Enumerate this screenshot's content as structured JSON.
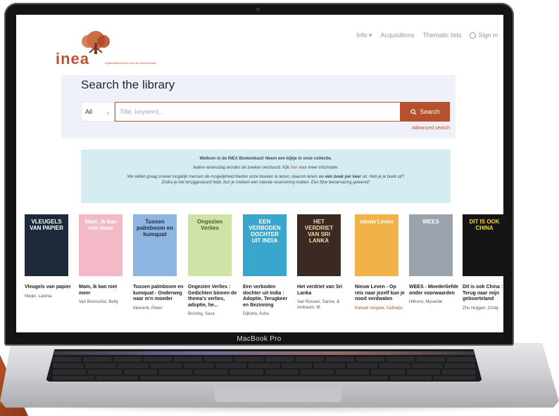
{
  "device": {
    "label": "MacBook Pro"
  },
  "brand": {
    "logo_text": "inea",
    "logo_subtitle": "organisatiecentrum voor de fijne educatie"
  },
  "nav": {
    "info": "Info",
    "acquisitions": "Acquisitions",
    "thematic_lists": "Thematic lists",
    "sign_in": "Sign in"
  },
  "search": {
    "title": "Search the library",
    "scope": "All",
    "placeholder": "Title, keyword...",
    "button": "Search",
    "advanced": "Advanced search"
  },
  "welcome": {
    "line1": "Welkom in de INEA Boekenkast! Neem een kijkje in onze collectie.",
    "line2_a": "Iedere woensdag worden de boeken verstuurd. Kijk ",
    "line2_link": "hier",
    "line2_b": " voor meer informatie.",
    "line3_a": "We willen graag zoveel mogelijk mensen de mogelijkheid bieden onze boeken te lezen, daarom lenen we ",
    "line3_bold": "één boek per keer",
    "line3_b": " uit. Heb je je boek uit?",
    "line4": "Zodra je het teruggestuurd hebt, kun je meteen een nieuwe reservering maken. Een fijne leeservaring gewenst!"
  },
  "books": [
    {
      "title": "Vleugels van papier",
      "author": "Meijer, Lavinia",
      "cover_text": "VLEUGELS VAN PAPIER",
      "cover_bg": "#1d2a3a",
      "cover_fg": "#ffffff",
      "author_red": false
    },
    {
      "title": "Mam, ik kan niet meer",
      "author": "Van Brunschot, Betty",
      "cover_text": "Mam, ik kan niet meer",
      "cover_bg": "#f4b9c7",
      "cover_fg": "#ffffff",
      "author_red": false
    },
    {
      "title": "Tussen palmboom en kumquat - Onderweg naar m'n moeder",
      "author": "Meenink, Pieter",
      "cover_text": "Tussen palmboom en kumquat",
      "cover_bg": "#8fb6e0",
      "cover_fg": "#1c2d4a",
      "author_red": false
    },
    {
      "title": "Ongezien Verlies : Gedichten binnen de thema's verlies, adoptie, he...",
      "author": "Brüning, Sasa",
      "cover_text": "Ongezien Verlies",
      "cover_bg": "#cfe3a8",
      "cover_fg": "#4a5a2a",
      "author_red": false
    },
    {
      "title": "Een verboden dochter uit India : Adoptie, Terugkeer en Bezinning",
      "author": "Dijkstra, Asha",
      "cover_text": "EEN VERBODEN DOCHTER UIT INDIA",
      "cover_bg": "#3aa6cc",
      "cover_fg": "#ffffff",
      "author_red": false
    },
    {
      "title": "Het verdriet van Sri Lanka",
      "author": "Van Rossen, Sanne, & Ambaum, M.",
      "cover_text": "HET VERDRIET VAN SRI LANKA",
      "cover_bg": "#3a2a22",
      "cover_fg": "#f0d8b0",
      "author_red": false
    },
    {
      "title": "Nieuw Leven - Op reis naar jezelf kun je nooit verdwalen",
      "author": "Kaiwati Vergeer, Kathalijn",
      "cover_text": "nieuw Leven",
      "cover_bg": "#f2b24a",
      "cover_fg": "#ffffff",
      "author_red": true
    },
    {
      "title": "WEES - Moederliefde onder voorwaarden",
      "author": "Hilhorst, Myrande",
      "cover_text": "WEES",
      "cover_bg": "#9aa3ad",
      "cover_fg": "#ffffff",
      "author_red": false
    },
    {
      "title": "Dit is ook China : Terug naar mijn geboorteland",
      "author": "Zhu Huijgen, Cindy",
      "cover_text": "DIT IS OOK CHINA",
      "cover_bg": "#151515",
      "cover_fg": "#f4d23a",
      "author_red": false
    }
  ]
}
